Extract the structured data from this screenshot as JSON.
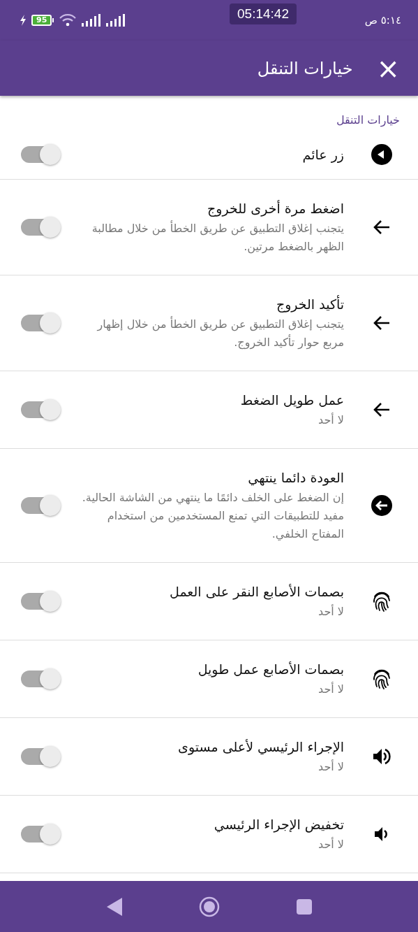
{
  "status_bar": {
    "battery": "95",
    "timer": "05:14:42",
    "clock": "٥:١٤ ص"
  },
  "app_bar": {
    "title": "خيارات التنقل",
    "close": "×"
  },
  "section": {
    "title": "خيارات التنقل"
  },
  "items": [
    {
      "kind": "circle-play-back",
      "title": "زر عائم",
      "on": false
    },
    {
      "kind": "arrow",
      "title": "اضغط مرة أخرى للخروج",
      "description": "يتجنب إغلاق التطبيق عن طريق الخطأ من خلال مطالبة الظهر بالضغط مرتين.",
      "on": false
    },
    {
      "kind": "arrow",
      "title": "تأكيد الخروج",
      "description": "يتجنب إغلاق التطبيق عن طريق الخطأ من خلال إظهار مربع حوار تأكيد الخروج.",
      "on": false
    },
    {
      "kind": "arrow",
      "title": "عمل طويل الضغط",
      "description": "لا أحد",
      "on": false
    },
    {
      "kind": "circle-arrow",
      "title": "العودة دائما ينتهي",
      "description": "إن الضغط على الخلف دائمًا ما ينتهي من الشاشة الحالية. مفيد للتطبيقات التي تمنع المستخدمين من استخدام المفتاح الخلفي.",
      "on": false
    },
    {
      "kind": "fingerprint",
      "title": "بصمات الأصابع النقر على العمل",
      "description": "لا أحد",
      "on": false
    },
    {
      "kind": "fingerprint",
      "title": "بصمات الأصابع عمل طويل",
      "description": "لا أحد",
      "on": false
    },
    {
      "kind": "volume-up",
      "title": "الإجراء الرئيسي لأعلى مستوى",
      "description": "لا أحد",
      "on": false
    },
    {
      "kind": "volume-down",
      "title": "تخفيض الإجراء الرئيسي",
      "description": "لا أحد",
      "on": false
    }
  ]
}
